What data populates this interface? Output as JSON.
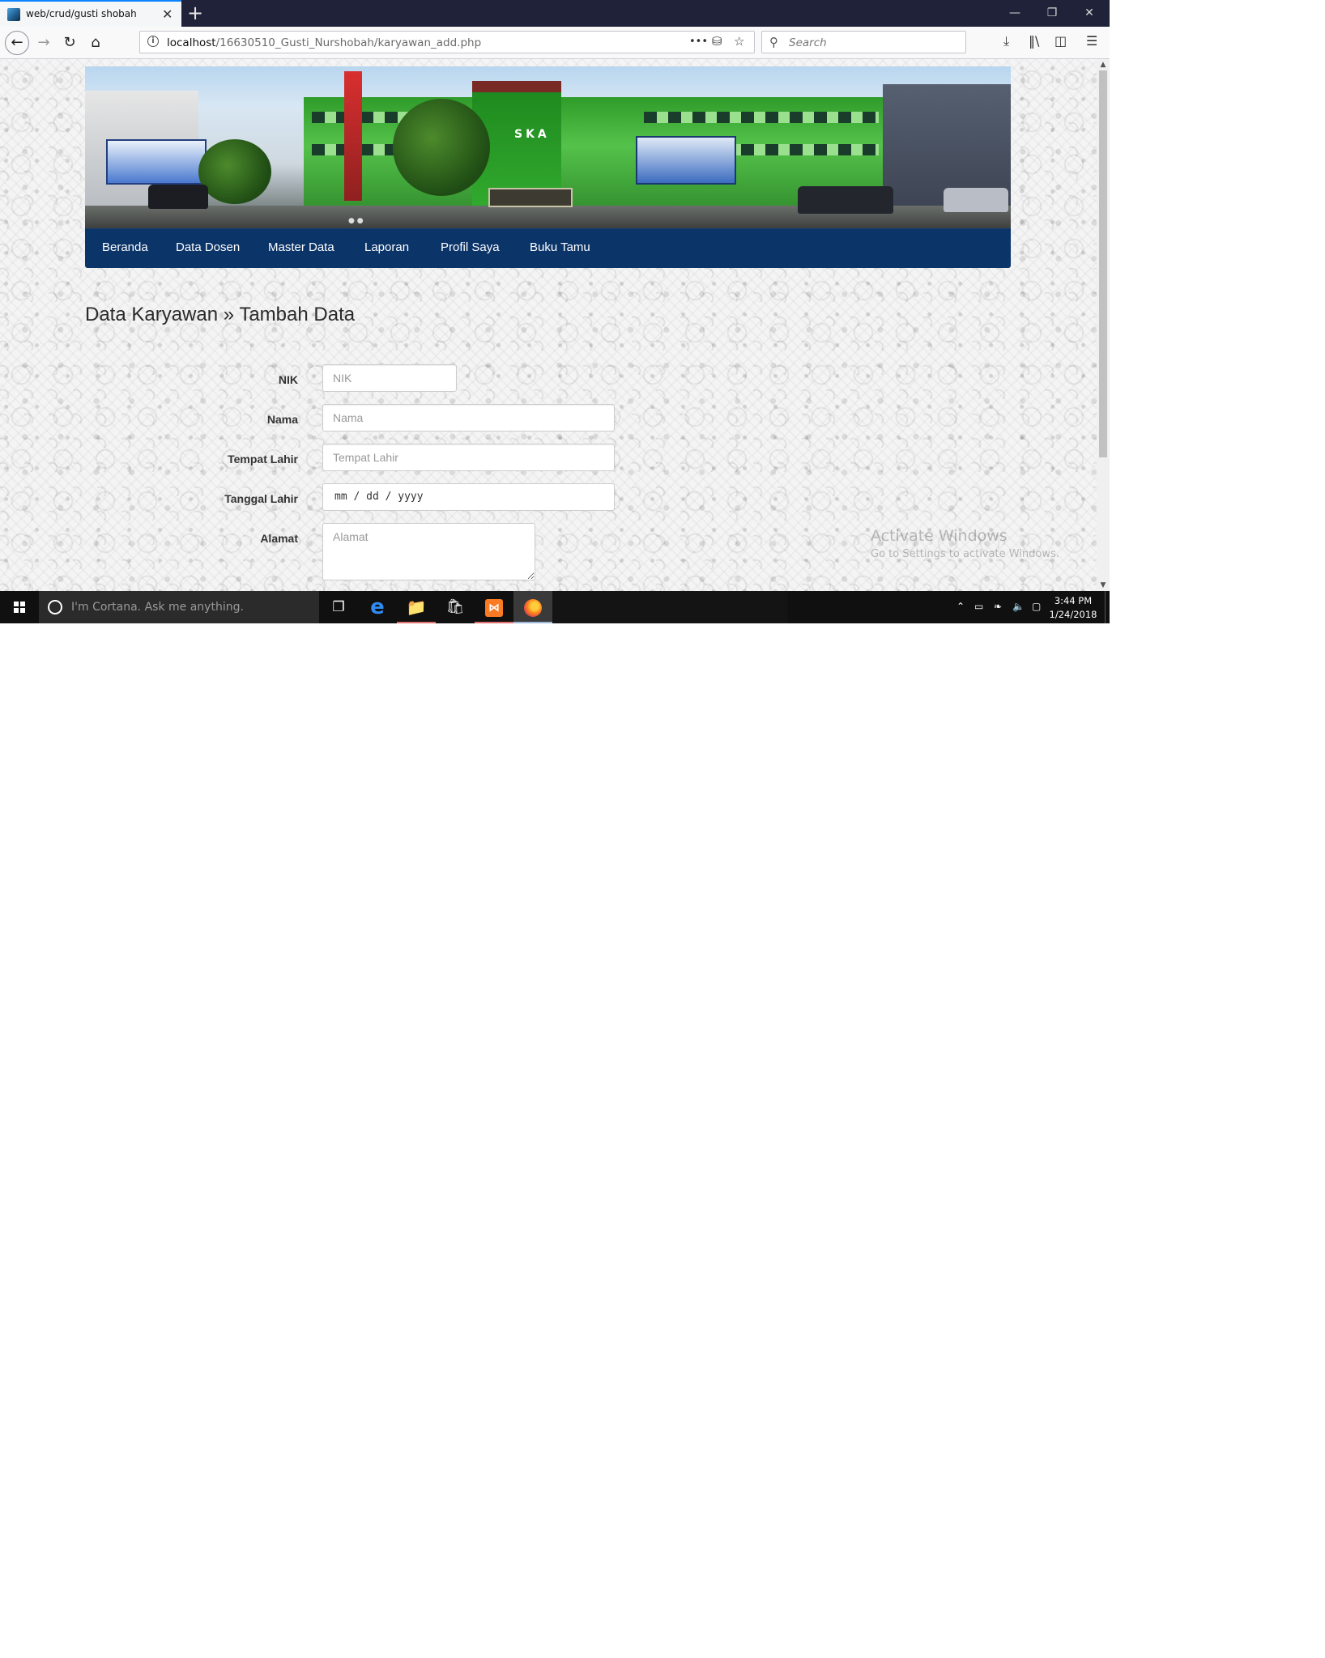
{
  "browser": {
    "tab_title": "web/crud/gusti shobah",
    "tab_close": "✕",
    "new_tab": "+",
    "url_host": "localhost",
    "url_path": "/16630510_Gusti_Nurshobah/karyawan_add.php",
    "url_more": "•••",
    "search_placeholder": "Search"
  },
  "site": {
    "banner_title": "SKA",
    "menu": [
      "Beranda",
      "Data Dosen",
      "Master Data",
      "Laporan",
      "Profil Saya",
      "Buku Tamu"
    ]
  },
  "page": {
    "heading": "Data Karyawan » Tambah Data"
  },
  "form": {
    "nik": {
      "label": "NIK",
      "placeholder": "NIK",
      "value": ""
    },
    "nama": {
      "label": "Nama",
      "placeholder": "Nama",
      "value": ""
    },
    "tempat_lahir": {
      "label": "Tempat Lahir",
      "placeholder": "Tempat Lahir",
      "value": ""
    },
    "tanggal_lahir": {
      "label": "Tanggal Lahir",
      "display": "mm / dd / yyyy"
    },
    "alamat": {
      "label": "Alamat",
      "placeholder": "Alamat",
      "value": ""
    }
  },
  "watermark": {
    "title": "Activate Windows",
    "subtitle": "Go to Settings to activate Windows."
  },
  "taskbar": {
    "cortana_text": "I'm Cortana. Ask me anything.",
    "time": "3:44 PM",
    "date": "1/24/2018"
  },
  "colors": {
    "menu_bg": "#0b3469",
    "titlebar_bg": "#1f2238",
    "tab_accent": "#0a84ff",
    "taskbar_bg": "#101010"
  }
}
